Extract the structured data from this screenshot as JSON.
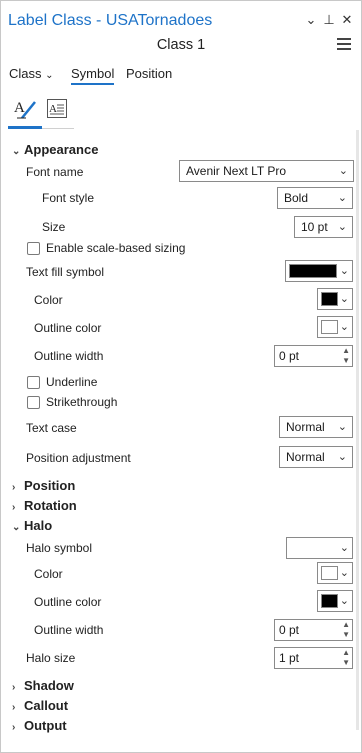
{
  "header": {
    "title": "Label Class - USATornadoes",
    "class_name": "Class 1"
  },
  "tabs": [
    {
      "label": "Class"
    },
    {
      "label": "Symbol"
    },
    {
      "label": "Position"
    }
  ],
  "appearance": {
    "section": "Appearance",
    "font_name_label": "Font name",
    "font_name_value": "Avenir Next LT Pro",
    "font_style_label": "Font style",
    "font_style_value": "Bold",
    "size_label": "Size",
    "size_value": "10 pt",
    "scale_sizing_label": "Enable scale-based sizing",
    "text_fill_label": "Text fill symbol",
    "color_label": "Color",
    "outline_color_label": "Outline color",
    "outline_width_label": "Outline width",
    "outline_width_value": "0 pt",
    "underline_label": "Underline",
    "strikethrough_label": "Strikethrough",
    "text_case_label": "Text case",
    "text_case_value": "Normal",
    "position_adj_label": "Position adjustment",
    "position_adj_value": "Normal"
  },
  "sections": {
    "position": "Position",
    "rotation": "Rotation",
    "halo": "Halo",
    "shadow": "Shadow",
    "callout": "Callout",
    "output": "Output"
  },
  "halo": {
    "symbol_label": "Halo symbol",
    "color_label": "Color",
    "outline_color_label": "Outline color",
    "outline_width_label": "Outline width",
    "outline_width_value": "0 pt",
    "size_label": "Halo size",
    "size_value": "1 pt"
  },
  "colors": {
    "accent": "#1e73c8",
    "text_fill": "#000000",
    "text_color": "#000000",
    "text_outline": "#ffffff",
    "halo_color": "#ffffff",
    "halo_outline": "#000000"
  }
}
